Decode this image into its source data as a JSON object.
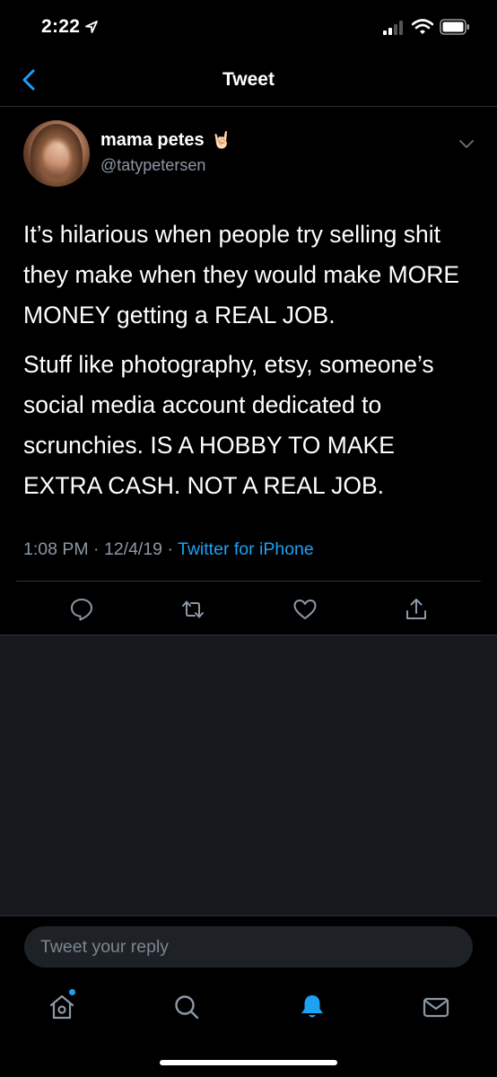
{
  "status_bar": {
    "time": "2:22",
    "icons": [
      "location-arrow-icon",
      "cellular-signal-icon",
      "wifi-icon",
      "battery-icon"
    ]
  },
  "nav": {
    "title": "Tweet",
    "back_icon": "chevron-left-icon"
  },
  "tweet": {
    "display_name": "mama petes",
    "name_emoji": "🤘🏻",
    "handle": "@tatypetersen",
    "paragraphs": [
      "It’s hilarious when people try selling shit they make when they would make MORE MONEY getting a REAL JOB.",
      "Stuff like photography, etsy, someone’s social media account dedicated to scrunchies. IS A HOBBY TO MAKE EXTRA CASH.  NOT A REAL JOB."
    ],
    "time": "1:08 PM",
    "date": "12/4/19",
    "separator": " · ",
    "source": "Twitter for iPhone",
    "actions": [
      "reply-icon",
      "retweet-icon",
      "like-icon",
      "share-icon"
    ]
  },
  "reply": {
    "placeholder": "Tweet your reply"
  },
  "tab_bar": {
    "tabs": [
      "home-icon",
      "search-icon",
      "notifications-icon",
      "messages-icon"
    ],
    "active": "notifications-icon"
  },
  "colors": {
    "accent": "#1da1f2",
    "secondary_text": "#8b98a5",
    "background": "#000000",
    "empty_area": "#15181c"
  }
}
